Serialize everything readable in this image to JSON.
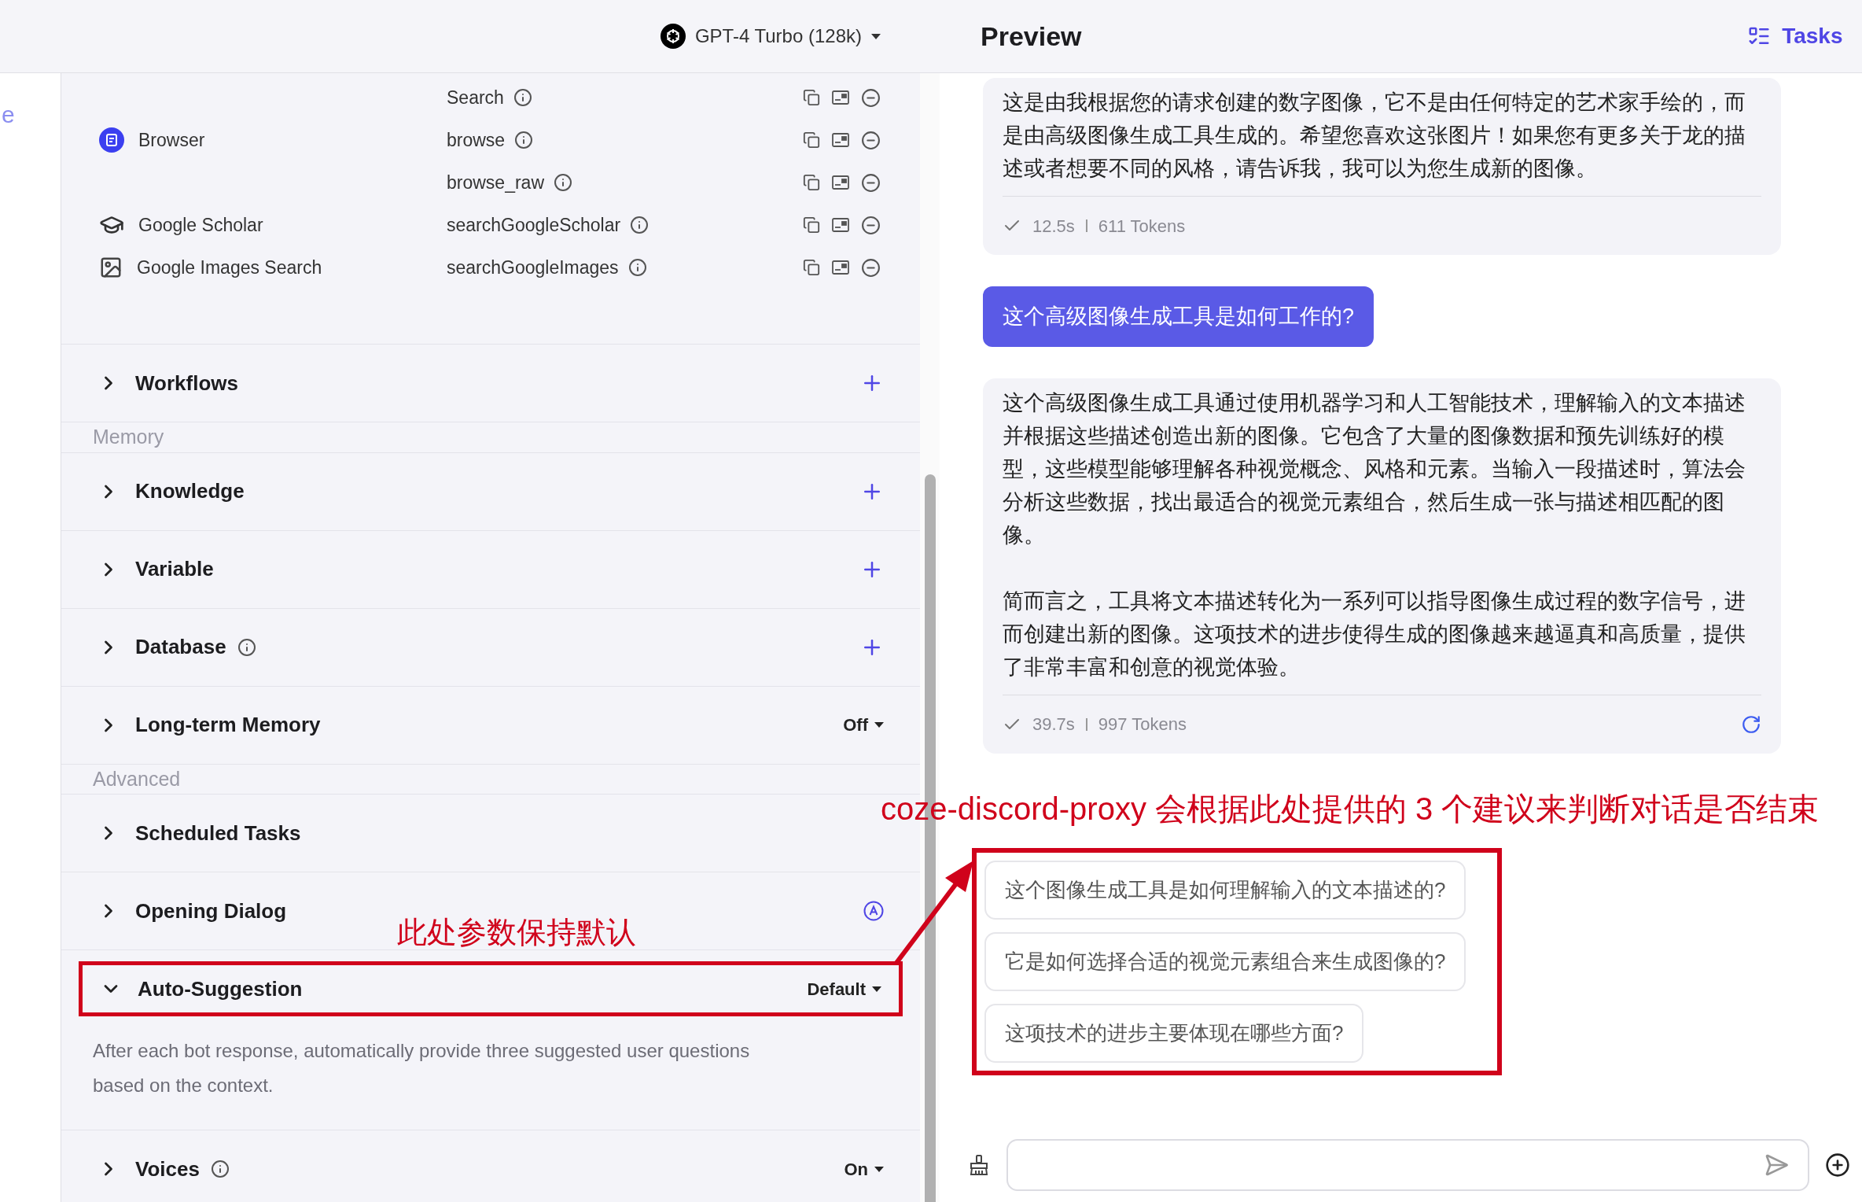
{
  "left_strip": {
    "text": "e"
  },
  "model_selector": {
    "label": "GPT-4 Turbo (128k)"
  },
  "tool_rows": [
    {
      "tool": "Search"
    },
    {
      "plugin": "Browser",
      "kind": "browser",
      "tool": "browse"
    },
    {
      "tool": "browse_raw"
    },
    {
      "plugin": "Google Scholar",
      "kind": "scholar",
      "tool": "searchGoogleScholar"
    },
    {
      "plugin": "Google Images Search",
      "kind": "images",
      "tool": "searchGoogleImages"
    }
  ],
  "sections": [
    {
      "kind": "section",
      "title": "Workflows",
      "addable": true,
      "expanded": false
    },
    {
      "kind": "group_label",
      "title": "Memory"
    },
    {
      "kind": "section",
      "title": "Knowledge",
      "addable": true,
      "expanded": false
    },
    {
      "kind": "section",
      "title": "Variable",
      "addable": true,
      "expanded": false
    },
    {
      "kind": "section",
      "title": "Database",
      "info": true,
      "addable": true,
      "expanded": false
    },
    {
      "kind": "section",
      "title": "Long-term Memory",
      "value": "Off",
      "expanded": false
    },
    {
      "kind": "group_label",
      "title": "Advanced"
    },
    {
      "kind": "section",
      "title": "Scheduled Tasks",
      "expanded": false
    },
    {
      "kind": "section",
      "title": "Opening Dialog",
      "auto": true,
      "expanded": false
    },
    {
      "kind": "section",
      "title": "Auto-Suggestion",
      "value": "Default",
      "expanded": true,
      "highlighted": true,
      "description": "After each bot response, automatically provide three suggested user questions based on the context."
    },
    {
      "kind": "section",
      "title": "Voices",
      "info": true,
      "value": "On",
      "expanded": false
    }
  ],
  "preview": {
    "title": "Preview",
    "tasks_label": "Tasks"
  },
  "messages": [
    {
      "kind": "bot",
      "paragraphs": [
        "这是由我根据您的请求创建的数字图像，它不是由任何特定的艺术家手绘的，而是由高级图像生成工具生成的。希望您喜欢这张图片！如果您有更多关于龙的描述或者想要不同的风格，请告诉我，我可以为您生成新的图像。"
      ],
      "time": "12.5s",
      "tokens": "611 Tokens",
      "regenerate": false
    },
    {
      "kind": "user",
      "text": "这个高级图像生成工具是如何工作的?"
    },
    {
      "kind": "bot",
      "paragraphs": [
        "这个高级图像生成工具通过使用机器学习和人工智能技术，理解输入的文本描述并根据这些描述创造出新的图像。它包含了大量的图像数据和预先训练好的模型，这些模型能够理解各种视觉概念、风格和元素。当输入一段描述时，算法会分析这些数据，找出最适合的视觉元素组合，然后生成一张与描述相匹配的图像。",
        "简而言之，工具将文本描述转化为一系列可以指导图像生成过程的数字信号，进而创建出新的图像。这项技术的进步使得生成的图像越来越逼真和高质量，提供了非常丰富和创意的视觉体验。"
      ],
      "time": "39.7s",
      "tokens": "997 Tokens",
      "regenerate": true
    }
  ],
  "suggestions": {
    "highlighted": true,
    "items": [
      "这个图像生成工具是如何理解输入的文本描述的?",
      "它是如何选择合适的视觉元素组合来生成图像的?",
      "这项技术的进步主要体现在哪些方面?"
    ]
  },
  "annotations": [
    {
      "text": "此处参数保持默认"
    },
    {
      "text": "coze-discord-proxy 会根据此处提供的 3 个建议来判断对话是否结束"
    }
  ]
}
